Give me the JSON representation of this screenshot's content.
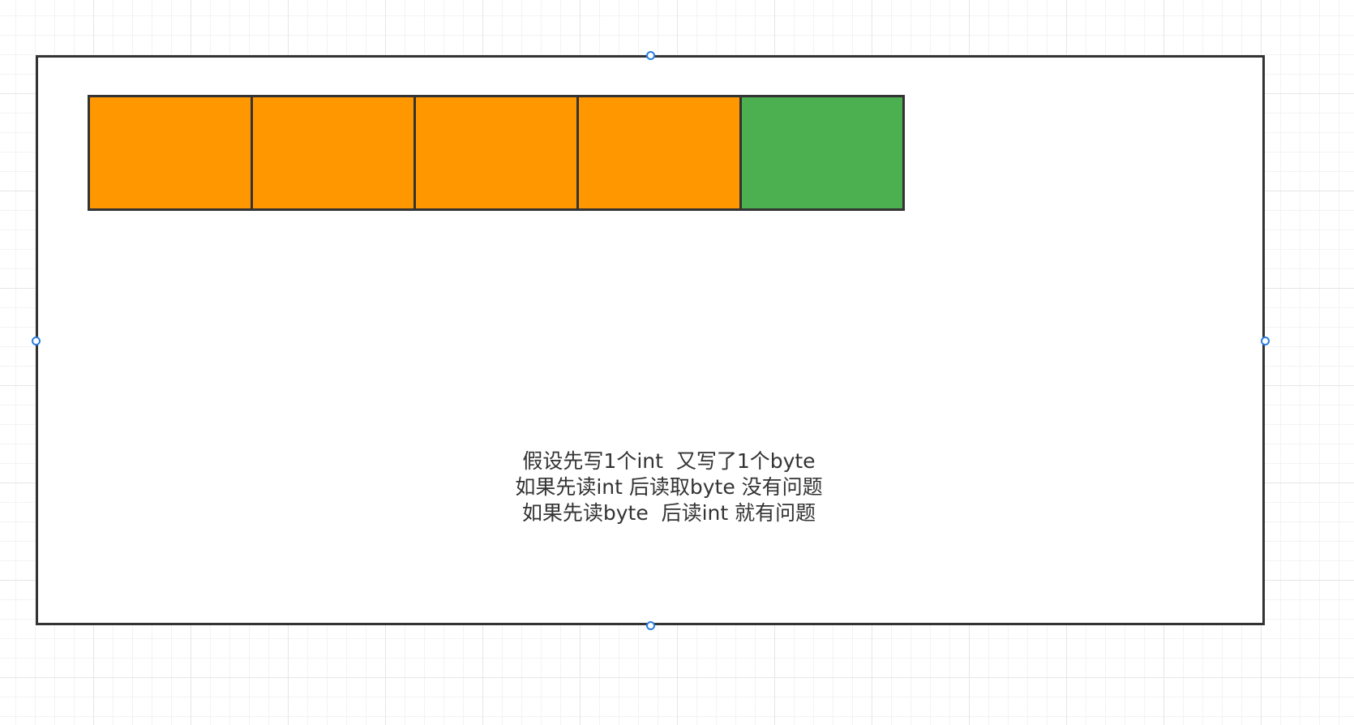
{
  "diagram": {
    "cells": [
      {
        "color": "#ff9800",
        "kind": "int-byte"
      },
      {
        "color": "#ff9800",
        "kind": "int-byte"
      },
      {
        "color": "#ff9800",
        "kind": "int-byte"
      },
      {
        "color": "#ff9800",
        "kind": "int-byte"
      },
      {
        "color": "#4caf50",
        "kind": "byte"
      }
    ],
    "note": {
      "line1": "假设先写1个int  又写了1个byte",
      "line2": "如果先读int 后读取byte 没有问题",
      "line3": "如果先读byte  后读int 就有问题"
    }
  },
  "colors": {
    "stroke": "#333333",
    "selection": "#2a7de1"
  }
}
